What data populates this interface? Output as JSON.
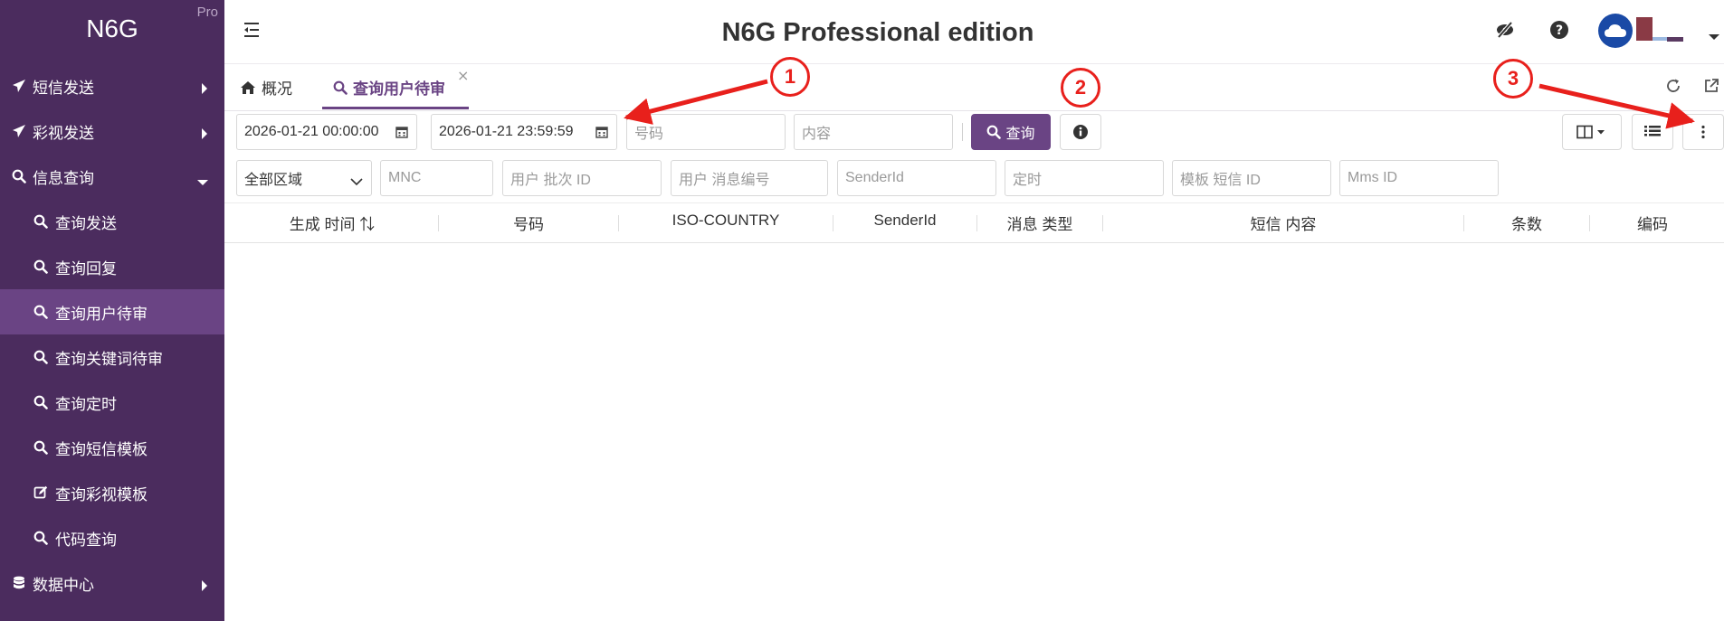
{
  "brand": {
    "name": "N6G",
    "badge": "Pro"
  },
  "header": {
    "title": "N6G Professional edition"
  },
  "sidebar": {
    "items": [
      {
        "label": "短信发送",
        "icon": "paper-plane-icon"
      },
      {
        "label": "彩视发送",
        "icon": "paper-plane-icon"
      },
      {
        "label": "信息查询",
        "icon": "search-icon"
      },
      {
        "label": "查询发送",
        "icon": "search-icon"
      },
      {
        "label": "查询回复",
        "icon": "search-icon"
      },
      {
        "label": "查询用户待审",
        "icon": "search-icon"
      },
      {
        "label": "查询关键词待审",
        "icon": "search-icon"
      },
      {
        "label": "查询定时",
        "icon": "search-icon"
      },
      {
        "label": "查询短信模板",
        "icon": "search-icon"
      },
      {
        "label": "查询彩视模板",
        "icon": "edit-icon"
      },
      {
        "label": "代码查询",
        "icon": "search-icon"
      },
      {
        "label": "数据中心",
        "icon": "database-icon"
      }
    ]
  },
  "tabs": [
    {
      "label": "概况",
      "icon": "home-icon"
    },
    {
      "label": "查询用户待审",
      "icon": "search-icon",
      "active": true
    }
  ],
  "tab_close": "×",
  "filters": {
    "start_time": "2026-01-21 00:00:00",
    "end_time": "2026-01-21 23:59:59",
    "number_placeholder": "号码",
    "content_placeholder": "内容",
    "query_label": "查询",
    "region_value": "全部区域",
    "mnc_placeholder": "MNC",
    "batch_id_placeholder": "用户 批次 ID",
    "msg_no_placeholder": "用户 消息编号",
    "sender_id_placeholder": "SenderId",
    "schedule_placeholder": "定时",
    "template_id_placeholder": "模板 短信 ID",
    "mms_id_placeholder": "Mms ID"
  },
  "table": {
    "columns": [
      "生成 时间 ⇅",
      "号码",
      "ISO-COUNTRY",
      "SenderId",
      "消息 类型",
      "短信 内容",
      "条数",
      "编码"
    ]
  },
  "annotations": [
    "1",
    "2",
    "3"
  ],
  "colors": {
    "sidebar_bg": "#4b2c5e",
    "sidebar_active": "#6a4484",
    "accent": "#6a4484",
    "annotation": "#e8201c"
  }
}
